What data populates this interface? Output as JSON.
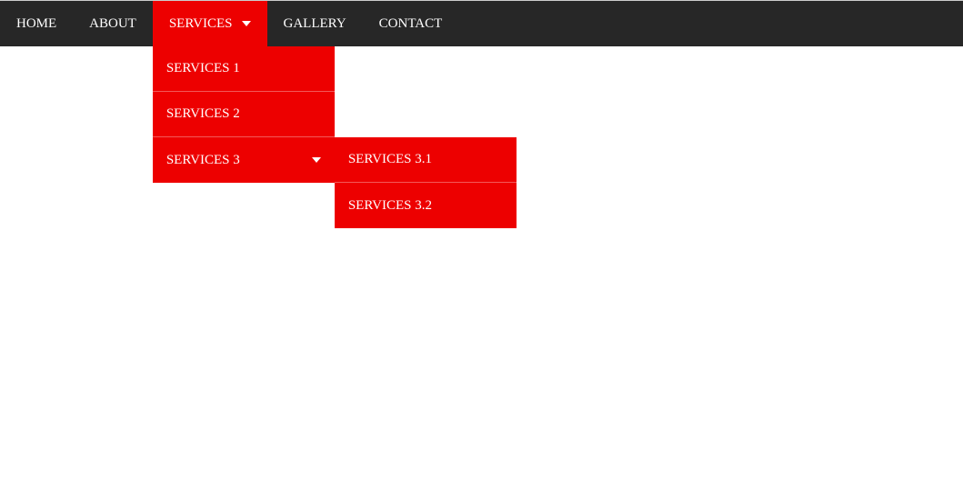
{
  "nav": {
    "items": [
      {
        "label": "HOME"
      },
      {
        "label": "ABOUT"
      },
      {
        "label": "SERVICES",
        "active": true
      },
      {
        "label": "GALLERY"
      },
      {
        "label": "CONTACT"
      }
    ]
  },
  "dropdown": {
    "items": [
      {
        "label": "SERVICES 1"
      },
      {
        "label": "SERVICES 2"
      },
      {
        "label": "SERVICES 3"
      }
    ]
  },
  "subdropdown": {
    "items": [
      {
        "label": "SERVICES 3.1"
      },
      {
        "label": "SERVICES 3.2"
      }
    ]
  }
}
